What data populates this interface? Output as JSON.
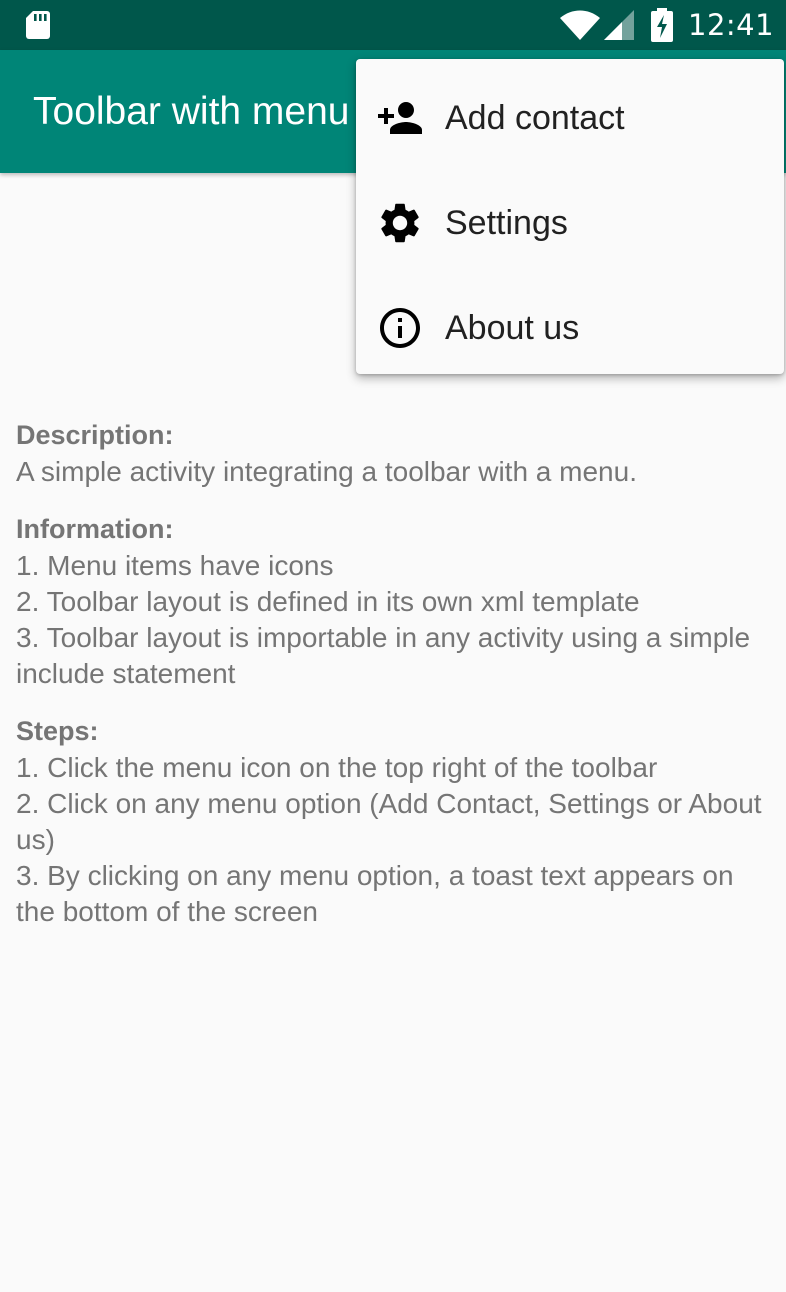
{
  "status_bar": {
    "time": "12:41",
    "icons": [
      "sd-card-icon",
      "wifi-icon",
      "cell-signal-icon",
      "battery-charging-icon"
    ]
  },
  "toolbar": {
    "title": "Toolbar with menu",
    "background": "#008577"
  },
  "menu": {
    "items": [
      {
        "label": "Add contact",
        "icon": "add-person-icon"
      },
      {
        "label": "Settings",
        "icon": "gear-icon"
      },
      {
        "label": "About us",
        "icon": "info-icon"
      }
    ]
  },
  "content": {
    "description": {
      "heading": "Description:",
      "lines": [
        "A simple activity integrating a toolbar with a menu."
      ]
    },
    "information": {
      "heading": "Information:",
      "lines": [
        "1. Menu items have icons",
        "2. Toolbar layout is defined in its own xml template",
        "3. Toolbar layout is importable in any activity using a simple include statement"
      ]
    },
    "steps": {
      "heading": "Steps:",
      "lines": [
        "1. Click the menu icon on the top right of the toolbar",
        "2. Click on any menu option (Add Contact, Settings or About us)",
        "3. By clicking on any menu option, a toast text appears on the bottom of the screen"
      ]
    }
  },
  "colors": {
    "status_bar": "#00574b",
    "toolbar": "#008577",
    "background": "#fafafa",
    "body_text": "#757575"
  }
}
